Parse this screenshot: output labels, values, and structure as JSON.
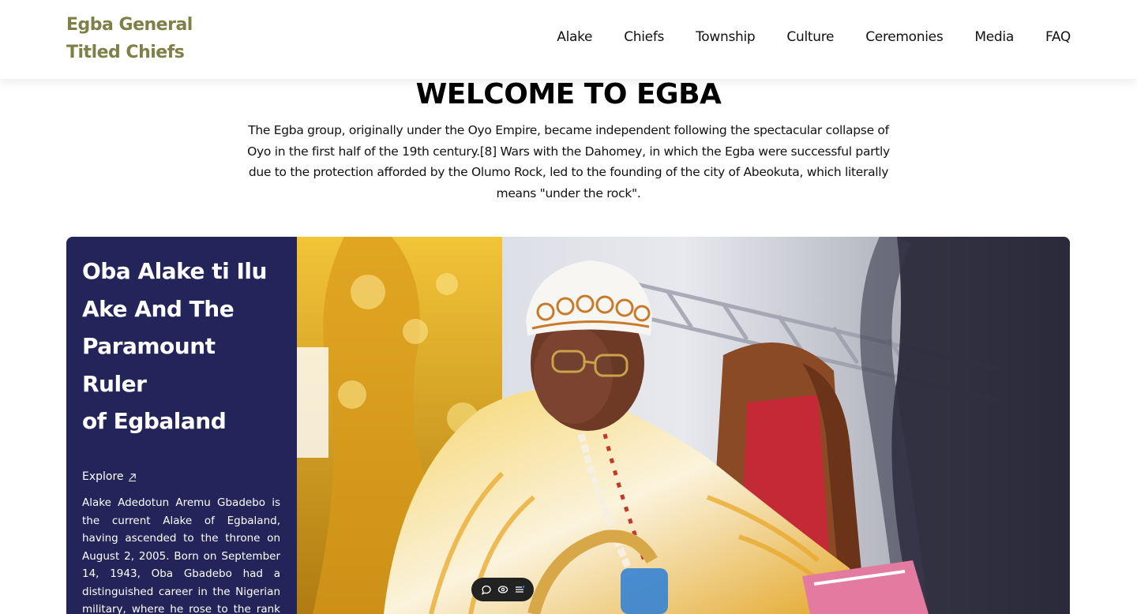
{
  "header": {
    "logo": "Egba General\nTitled Chiefs",
    "nav": [
      "Alake",
      "Chiefs",
      "Township",
      "Culture",
      "Ceremonies",
      "Media",
      "FAQ"
    ]
  },
  "welcome": {
    "title": "WELCOME TO EGBA",
    "intro": "The Egba group, originally under the  Oyo Empire, became  independent  following the spectacular collapse of Oyo in the first half of the 19th century.[8]  Wars with the Dahomey, in which the Egba were successful partly due to the protection afforded by the  Olumo Rock, led to the founding of the city of Abeokuta, which literally means \"under the rock\"."
  },
  "hero": {
    "title": "Oba Alake ti Ilu\nAke And The\nParamount\nRuler\nof Egbaland",
    "explore_label": "Explore",
    "bio": "Alake Adedotun Aremu Gbadebo is the current Alake of Egbaland, having ascended to the throne on August 2, 2005. Born on September 14, 1943, Oba Gbadebo had a distinguished career in the Nigerian military, where he rose to the rank of Colonel."
  },
  "colors": {
    "logo": "#7e8048",
    "hero_panel": "#22245a",
    "toolbar": "#222222"
  },
  "icons": {
    "explore": "arrow-up-right-icon",
    "toolbar": [
      "comment-icon",
      "eye-icon",
      "list-icon"
    ]
  }
}
